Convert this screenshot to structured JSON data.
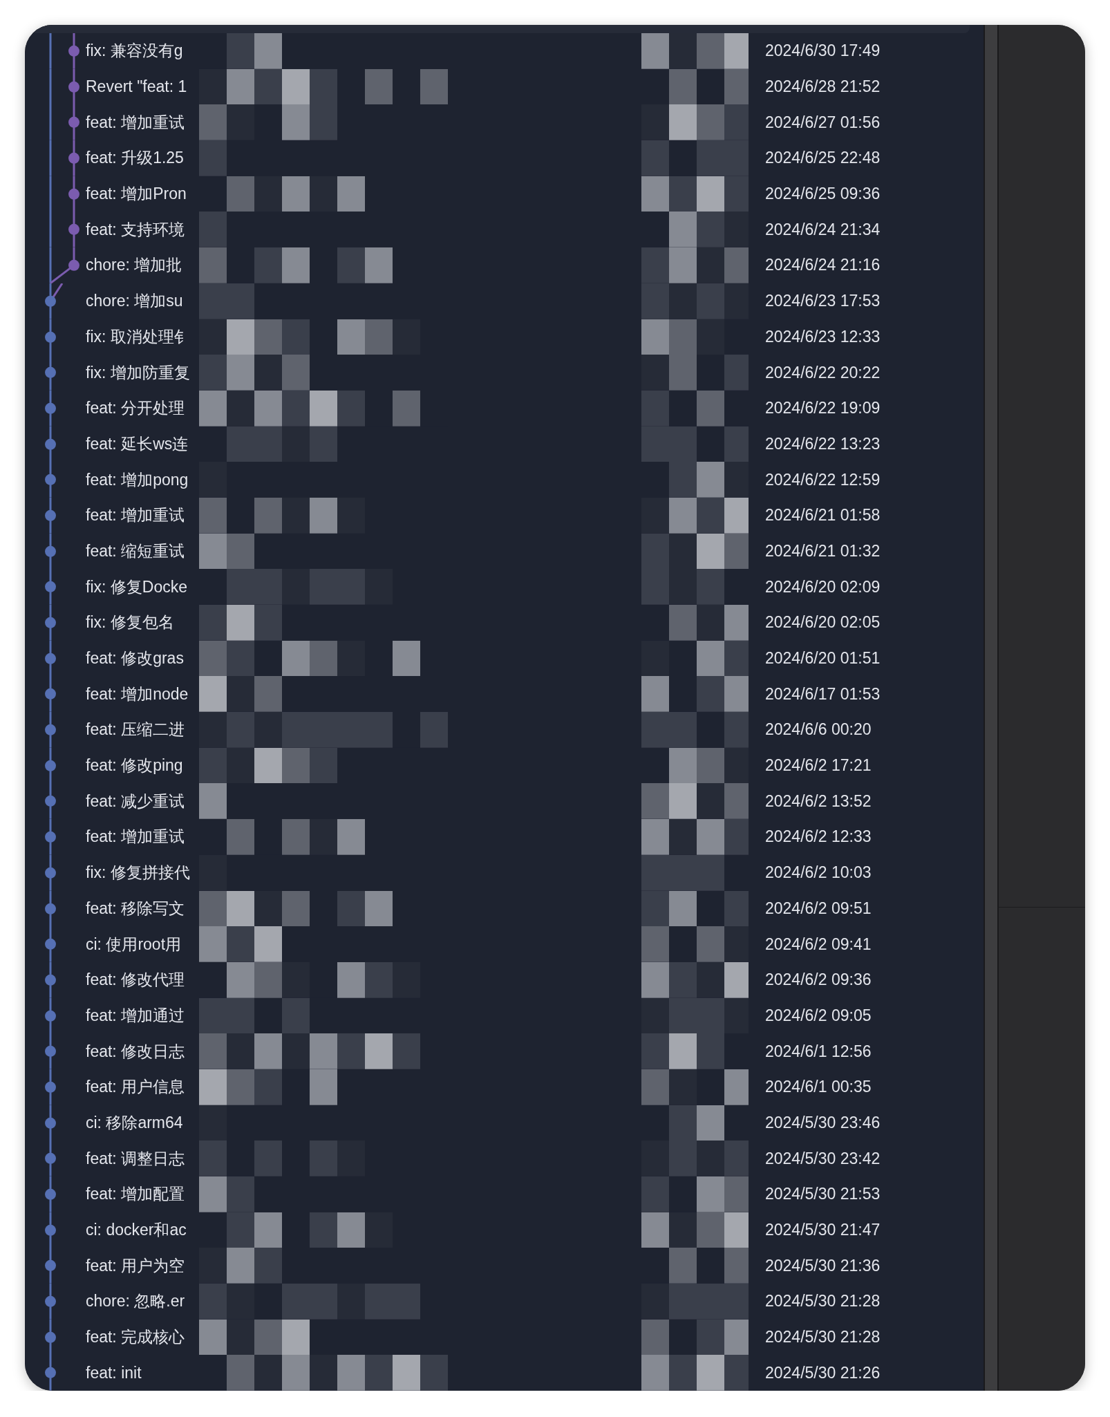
{
  "commits": [
    {
      "message": "fix: 兼容没有g",
      "date": "2024/6/30 17:49",
      "color": "#7b5caf"
    },
    {
      "message": "Revert \"feat: 1",
      "date": "2024/6/28 21:52",
      "color": "#7b5caf"
    },
    {
      "message": "feat: 增加重试",
      "date": "2024/6/27 01:56",
      "color": "#7b5caf"
    },
    {
      "message": "feat: 升级1.25",
      "date": "2024/6/25 22:48",
      "color": "#7b5caf"
    },
    {
      "message": "feat: 增加Pron",
      "date": "2024/6/25 09:36",
      "color": "#7b5caf"
    },
    {
      "message": "feat: 支持环境",
      "date": "2024/6/24 21:34",
      "color": "#7b5caf"
    },
    {
      "message": "chore: 增加批",
      "date": "2024/6/24 21:16",
      "color": "#7b5caf"
    },
    {
      "message": "chore: 增加su",
      "date": "2024/6/23 17:53",
      "color": "#5670b4"
    },
    {
      "message": "fix: 取消处理钅",
      "date": "2024/6/23 12:33",
      "color": "#5670b4"
    },
    {
      "message": "fix: 增加防重复",
      "date": "2024/6/22 20:22",
      "color": "#5670b4"
    },
    {
      "message": "feat: 分开处理",
      "date": "2024/6/22 19:09",
      "color": "#5670b4"
    },
    {
      "message": "feat: 延长ws连",
      "date": "2024/6/22 13:23",
      "color": "#5670b4"
    },
    {
      "message": "feat: 增加pong",
      "date": "2024/6/22 12:59",
      "color": "#5670b4"
    },
    {
      "message": "feat: 增加重试",
      "date": "2024/6/21 01:58",
      "color": "#5670b4"
    },
    {
      "message": "feat: 缩短重试",
      "date": "2024/6/21 01:32",
      "color": "#5670b4"
    },
    {
      "message": "fix: 修复Docke",
      "date": "2024/6/20 02:09",
      "color": "#5670b4"
    },
    {
      "message": "fix: 修复包名",
      "date": "2024/6/20 02:05",
      "color": "#5670b4"
    },
    {
      "message": "feat: 修改gras",
      "date": "2024/6/20 01:51",
      "color": "#5670b4"
    },
    {
      "message": "feat: 增加node",
      "date": "2024/6/17 01:53",
      "color": "#5670b4"
    },
    {
      "message": "feat: 压缩二进",
      "date": "2024/6/6 00:20",
      "color": "#5670b4"
    },
    {
      "message": "feat: 修改ping",
      "date": "2024/6/2 17:21",
      "color": "#5670b4"
    },
    {
      "message": "feat: 减少重试",
      "date": "2024/6/2 13:52",
      "color": "#5670b4"
    },
    {
      "message": "feat: 增加重试",
      "date": "2024/6/2 12:33",
      "color": "#5670b4"
    },
    {
      "message": "fix: 修复拼接代",
      "date": "2024/6/2 10:03",
      "color": "#5670b4"
    },
    {
      "message": "feat: 移除写文",
      "date": "2024/6/2 09:51",
      "color": "#5670b4"
    },
    {
      "message": "ci: 使用root用",
      "date": "2024/6/2 09:41",
      "color": "#5670b4"
    },
    {
      "message": "feat: 修改代理",
      "date": "2024/6/2 09:36",
      "color": "#5670b4"
    },
    {
      "message": "feat: 增加通过",
      "date": "2024/6/2 09:05",
      "color": "#5670b4"
    },
    {
      "message": "feat: 修改日志",
      "date": "2024/6/1 12:56",
      "color": "#5670b4"
    },
    {
      "message": "feat: 用户信息",
      "date": "2024/6/1 00:35",
      "color": "#5670b4"
    },
    {
      "message": "ci: 移除arm64",
      "date": "2024/5/30 23:46",
      "color": "#5670b4"
    },
    {
      "message": "feat: 调整日志",
      "date": "2024/5/30 23:42",
      "color": "#5670b4"
    },
    {
      "message": "feat: 增加配置",
      "date": "2024/5/30 21:53",
      "color": "#5670b4"
    },
    {
      "message": "ci: docker和ac",
      "date": "2024/5/30 21:47",
      "color": "#5670b4"
    },
    {
      "message": "feat: 用户为空",
      "date": "2024/5/30 21:36",
      "color": "#5670b4"
    },
    {
      "message": "chore: 忽略.er",
      "date": "2024/5/30 21:28",
      "color": "#5670b4"
    },
    {
      "message": "feat: 完成核心",
      "date": "2024/5/30 21:28",
      "color": "#5670b4"
    },
    {
      "message": "feat: init",
      "date": "2024/5/30 21:26",
      "color": "#5670b4"
    }
  ]
}
